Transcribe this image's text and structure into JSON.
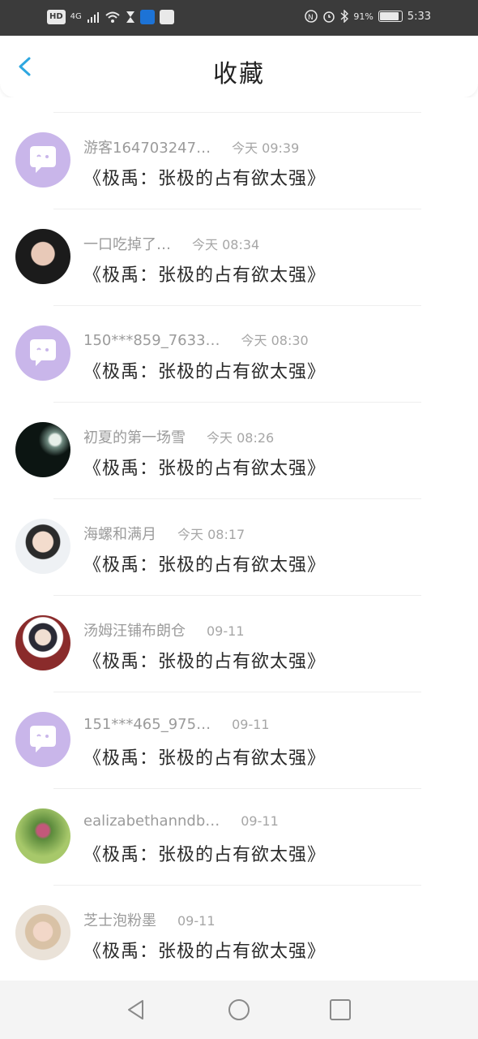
{
  "status_bar": {
    "left_badge": "HD",
    "network": "4G",
    "battery_percent": "91%",
    "time": "5:33",
    "battery_level": 0.91
  },
  "header": {
    "title": "收藏",
    "back_icon": "chevron-left-icon",
    "accent_color": "#2ea7e0"
  },
  "items": [
    {
      "name": "游客164703247…",
      "time": "今天 09:39",
      "message": "《极禹：张极的占有欲太强》",
      "avatar": "default-avatar"
    },
    {
      "name": "一口吃掉了…",
      "time": "今天 08:34",
      "message": "《极禹：张极的占有欲太强》",
      "avatar": "user-photo-1"
    },
    {
      "name": "150***859_7633…",
      "time": "今天 08:30",
      "message": "《极禹：张极的占有欲太强》",
      "avatar": "default-avatar"
    },
    {
      "name": "初夏的第一场雪",
      "time": "今天 08:26",
      "message": "《极禹：张极的占有欲太强》",
      "avatar": "moon-photo"
    },
    {
      "name": "海螺和满月",
      "time": "今天 08:17",
      "message": "《极禹：张极的占有欲太强》",
      "avatar": "user-photo-2"
    },
    {
      "name": "汤姆汪铺布朗仓",
      "time": "09-11",
      "message": "《极禹：张极的占有欲太强》",
      "avatar": "user-photo-3"
    },
    {
      "name": "151***465_975…",
      "time": "09-11",
      "message": "《极禹：张极的占有欲太强》",
      "avatar": "default-avatar"
    },
    {
      "name": "ealizabethanndb…",
      "time": "09-11",
      "message": "《极禹：张极的占有欲太强》",
      "avatar": "user-photo-4"
    },
    {
      "name": "芝士泡粉墨",
      "time": "09-11",
      "message": "《极禹：张极的占有欲太强》",
      "avatar": "user-photo-5"
    }
  ],
  "nav_bar": {
    "back_icon": "triangle-back-icon",
    "home_icon": "circle-home-icon",
    "recents_icon": "square-recents-icon"
  }
}
